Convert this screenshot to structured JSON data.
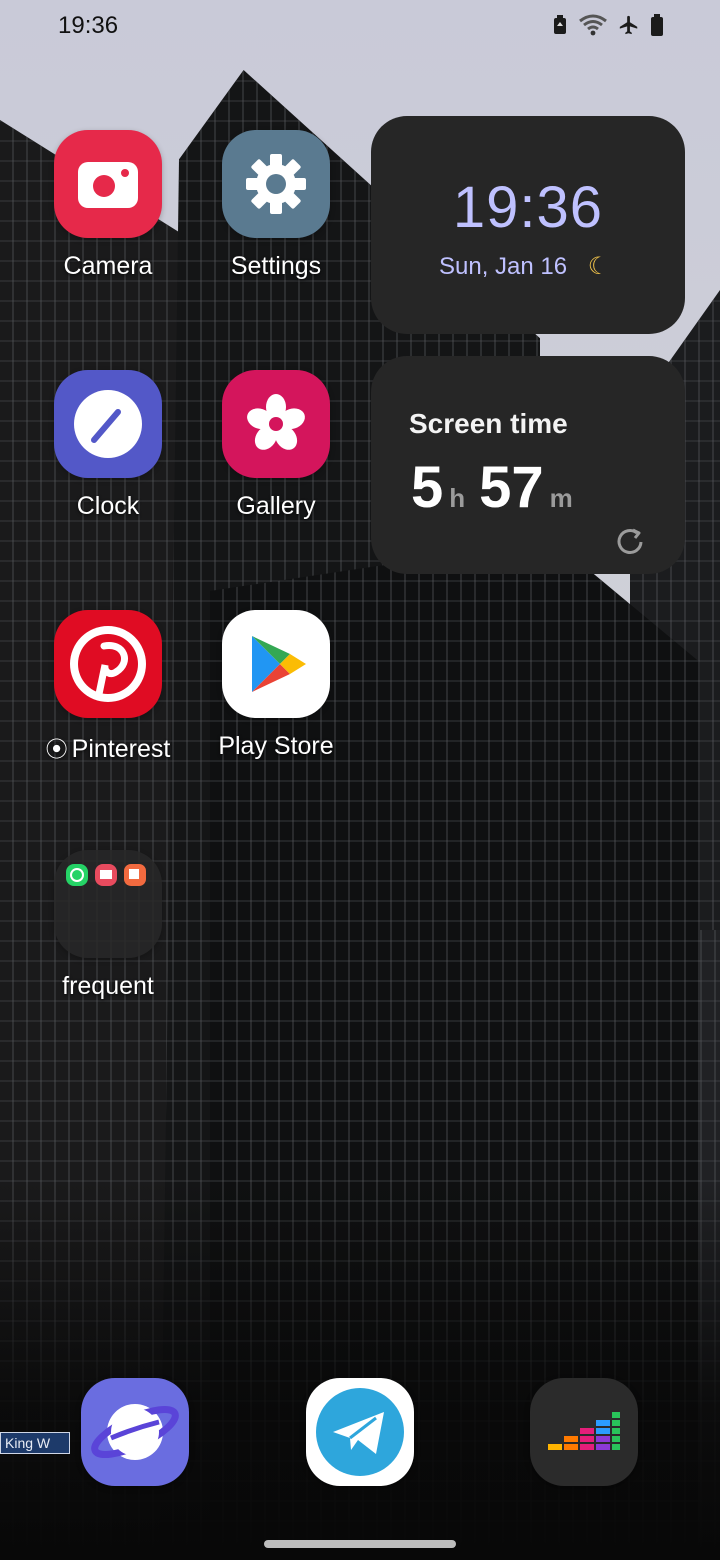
{
  "status_bar": {
    "time": "19:36",
    "icons": [
      "battery-saver-icon",
      "wifi-icon",
      "airplane-mode-icon",
      "battery-icon"
    ]
  },
  "apps": [
    {
      "label": "Camera",
      "icon": "camera-icon"
    },
    {
      "label": "Settings",
      "icon": "gear-icon"
    },
    {
      "label": "Clock",
      "icon": "clock-icon"
    },
    {
      "label": "Gallery",
      "icon": "flower-icon"
    },
    {
      "label": "Pinterest",
      "icon": "pinterest-icon",
      "badge": "⦿"
    },
    {
      "label": "Play Store",
      "icon": "play-store-icon"
    },
    {
      "label": "frequent",
      "icon": "folder-icon",
      "folder_items": [
        "whatsapp-icon",
        "book-icon",
        "notes-icon"
      ]
    }
  ],
  "clock_widget": {
    "time": "19:36",
    "date": "Sun, Jan 16",
    "moon": "🌙"
  },
  "screen_time_widget": {
    "title": "Screen time",
    "hours": "5",
    "hours_unit": "h",
    "minutes": "57",
    "minutes_unit": "m",
    "refresh_icon": "refresh-icon"
  },
  "dock": [
    {
      "name": "browser-icon",
      "color": "#6a6de0"
    },
    {
      "name": "telegram-icon",
      "color": "#2ea6dc"
    },
    {
      "name": "deezer-icon",
      "color": "#2b2b2b"
    }
  ],
  "wallpaper": {
    "street_sign": "King W"
  },
  "colors": {
    "camera": "#e6294a",
    "settings": "#5a7a90",
    "clock": "#5358c8",
    "gallery": "#d4155c",
    "pinterest": "#e00c23",
    "widget_bg": "#262626",
    "widget_accent": "#bfc1ff"
  }
}
